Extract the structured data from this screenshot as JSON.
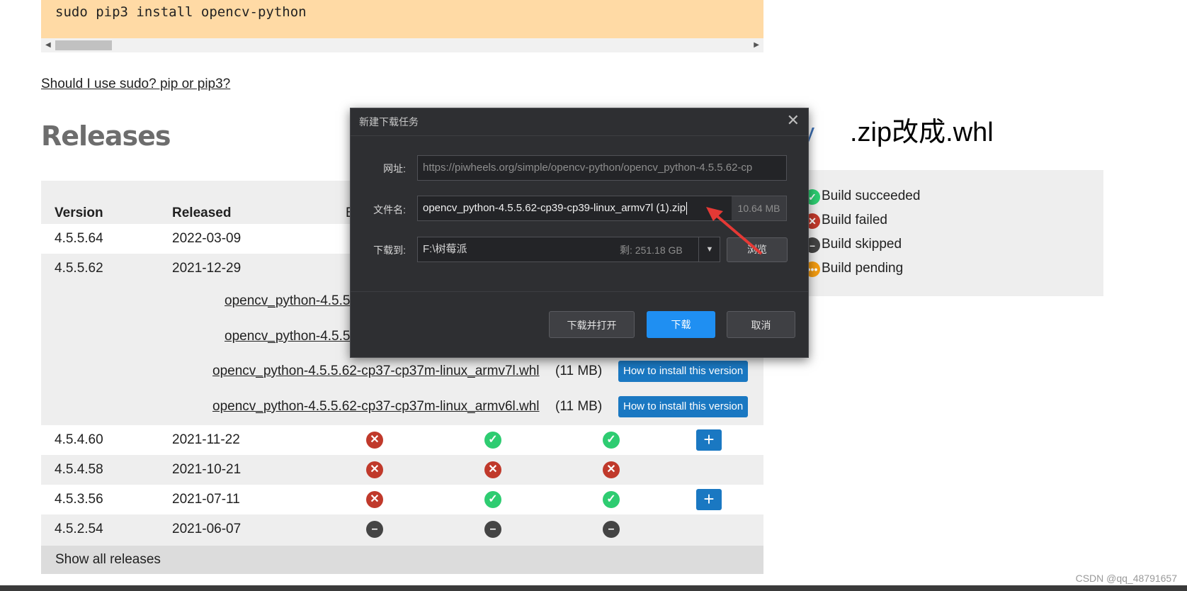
{
  "code": {
    "line": "sudo pip3 install opencv-python"
  },
  "links": {
    "sudo_pip": "Should I use sudo? pip or pip3?"
  },
  "releases": {
    "heading": "Releases",
    "headers": {
      "version": "Version",
      "released": "Released",
      "col3_partial": "B"
    },
    "rows": [
      {
        "version": "4.5.5.64",
        "date": "2022-03-09"
      },
      {
        "version": "4.5.5.62",
        "date": "2021-12-29"
      },
      {
        "version": "4.5.4.60",
        "date": "2021-11-22",
        "status": [
          "failed",
          "succeeded",
          "succeeded"
        ],
        "expand": true
      },
      {
        "version": "4.5.4.58",
        "date": "2021-10-21",
        "status": [
          "failed",
          "failed",
          "failed"
        ],
        "expand": false
      },
      {
        "version": "4.5.3.56",
        "date": "2021-07-11",
        "status": [
          "failed",
          "succeeded",
          "succeeded"
        ],
        "expand": true
      },
      {
        "version": "4.5.2.54",
        "date": "2021-06-07",
        "status": [
          "skipped",
          "skipped",
          "skipped"
        ],
        "expand": false
      }
    ],
    "wheels": [
      {
        "name": "opencv_python-4.5.5",
        "size": ""
      },
      {
        "name": "opencv_python-4.5.5",
        "size": ""
      },
      {
        "name": "opencv_python-4.5.5.62-cp37-cp37m-linux_armv7l.whl",
        "size": "(11 MB)",
        "button": "How to install this version"
      },
      {
        "name": "opencv_python-4.5.5.62-cp37-cp37m-linux_armv6l.whl",
        "size": "(11 MB)",
        "button": "How to install this version"
      }
    ],
    "show_all": "Show all releases"
  },
  "legend": {
    "items": [
      {
        "label": "Build succeeded",
        "status": "succeeded"
      },
      {
        "label": "Build failed",
        "status": "failed"
      },
      {
        "label": "Build skipped",
        "status": "skipped"
      },
      {
        "label": "Build pending",
        "status": "pending"
      }
    ]
  },
  "annotation": {
    "text": ".zip改成.whl",
    "partial_heading": "y"
  },
  "dialog": {
    "title": "新建下载任务",
    "url_label": "网址:",
    "url_value": "https://piwheels.org/simple/opencv-python/opencv_python-4.5.5.62-cp",
    "filename_label": "文件名:",
    "filename_value": "opencv_python-4.5.5.62-cp39-cp39-linux_armv7l (1).zip",
    "file_size": "10.64 MB",
    "saveto_label": "下载到:",
    "saveto_value": "F:\\树莓派",
    "free_space": "剩: 251.18 GB",
    "browse": "浏览",
    "download_open": "下载并打开",
    "download": "下载",
    "cancel": "取消"
  },
  "watermark": "CSDN @qq_48791657",
  "colors": {
    "accent": "#1a78c2",
    "ok": "#2ecc71",
    "fail": "#c0392b",
    "skip": "#444444",
    "pending": "#f39c12",
    "code_bg": "#ffdaa5",
    "dialog_bg": "#2e2f32",
    "primary_btn": "#1f8ff2"
  }
}
